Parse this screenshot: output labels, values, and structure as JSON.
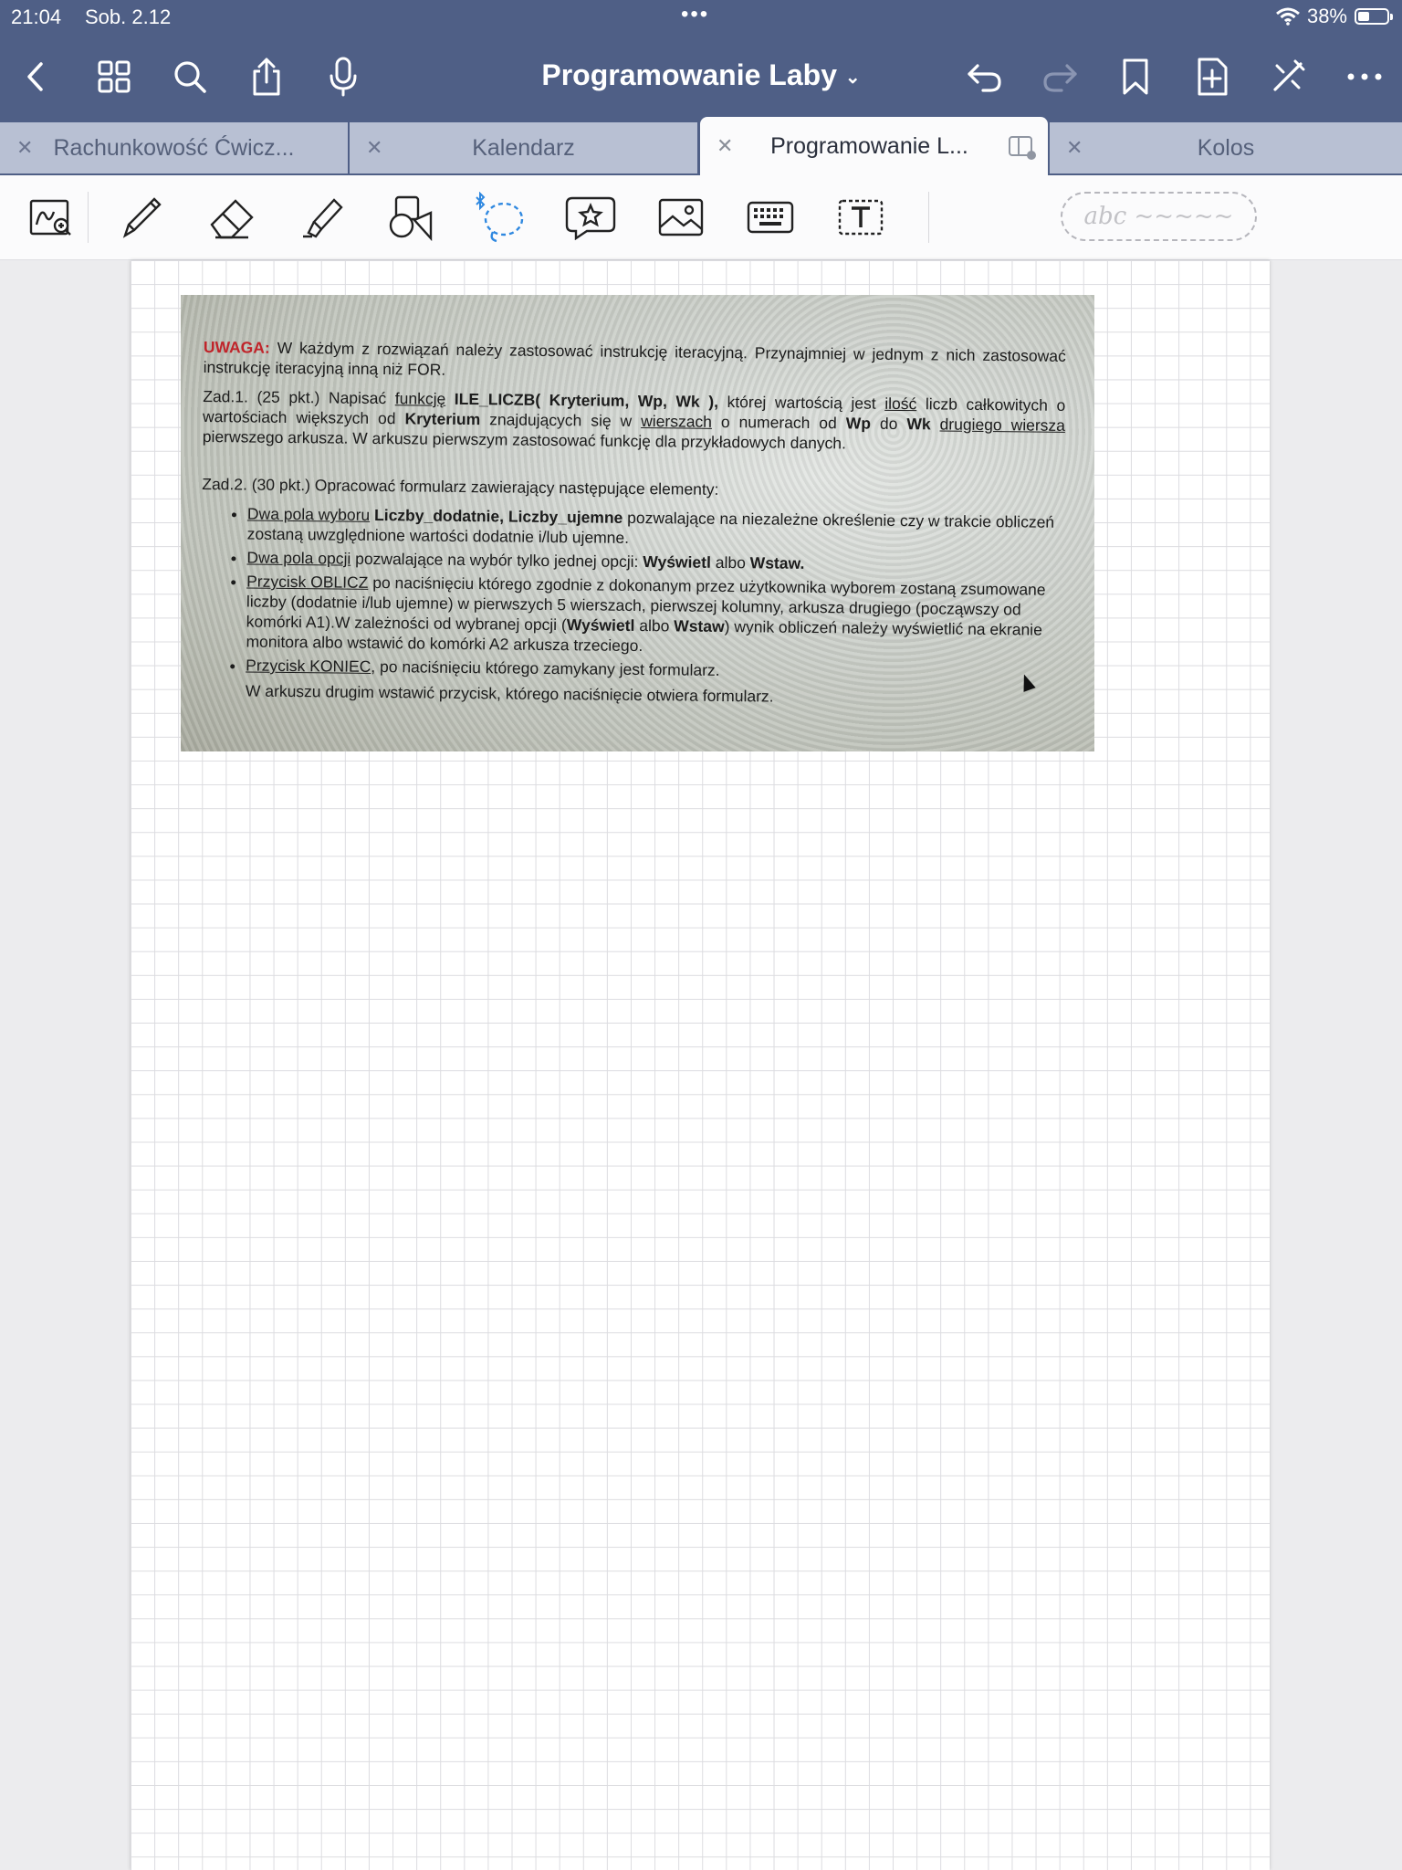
{
  "status_bar": {
    "time": "21:04",
    "date": "Sob. 2.12",
    "battery": "38%"
  },
  "navbar": {
    "title": "Programowanie Laby"
  },
  "tabs": [
    {
      "label": "Rachunkowość Ćwicz..."
    },
    {
      "label": "Kalendarz"
    },
    {
      "label": "Programowanie L...",
      "active": true
    },
    {
      "label": "Kolos"
    }
  ],
  "toolbar": {
    "handwriting_placeholder": "abc ~~~~~"
  },
  "colors": {
    "header": "#4f5f86",
    "tab_inactive": "#b8c0d3",
    "accent_blue": "#2f88e0",
    "warning_red": "#c0242a"
  },
  "photo": {
    "uwaga_label": "UWAGA:",
    "uwaga_text": "W każdym z rozwiązań należy zastosować instrukcję iteracyjną. Przynajmniej w jednym z nich zastosować instrukcję iteracyjną inną niż FOR.",
    "zad1_head": "Zad.1. (25 pkt.) Napisać",
    "zad1_funkcje": "funkcję",
    "zad1_sig": "ILE_LICZB( Kryterium, Wp, Wk ),",
    "zad1_text1": "której wartością jest",
    "zad1_ilosc": "ilość",
    "zad1_text2": "liczb całkowitych o wartościach większych od",
    "zad1_kryterium": "Kryterium",
    "zad1_text3": "znajdujących się w",
    "zad1_wierszach": "wierszach",
    "zad1_text4": "o numerach od",
    "zad1_wp": "Wp",
    "zad1_do": "do",
    "zad1_wk": "Wk",
    "zad1_drugiego": "drugiego wiersza",
    "zad1_text5": "pierwszego arkusza. W arkuszu pierwszym zastosować funkcję dla przykładowych danych.",
    "zad2_head": "Zad.2. (30 pkt.) Opracować formularz zawierający następujące elementy:",
    "b1_u": "Dwa pola wyboru",
    "b1_b": "Liczby_dodatnie, Liczby_ujemne",
    "b1_t": "pozwalające na niezależne określenie czy w trakcie obliczeń zostaną uwzględnione wartości dodatnie i/lub ujemne.",
    "b2_u": "Dwa pola opcji",
    "b2_t": "pozwalające na wybór tylko jednej opcji:",
    "b2_b1": "Wyświetl",
    "b2_albo": "albo",
    "b2_b2": "Wstaw.",
    "b3_u": "Przycisk OBLICZ",
    "b3_t1": "po naciśnięciu którego zgodnie z dokonanym przez użytkownika wyborem zostaną zsumowane liczby (dodatnie i/lub ujemne) w pierwszych 5 wierszach, pierwszej kolumny, arkusza drugiego (począwszy od komórki A1).W zależności od wybranej opcji (",
    "b3_b1": "Wyświetl",
    "b3_albo": "albo",
    "b3_b2": "Wstaw",
    "b3_t2": ") wynik obliczeń należy wyświetlić na ekranie monitora albo wstawić do komórki A2 arkusza trzeciego.",
    "b4_u": "Przycisk KONIEC",
    "b4_t": ", po naciśnięciu którego zamykany jest formularz.",
    "footer": "W arkuszu drugim wstawić przycisk, którego naciśnięcie otwiera formularz."
  }
}
